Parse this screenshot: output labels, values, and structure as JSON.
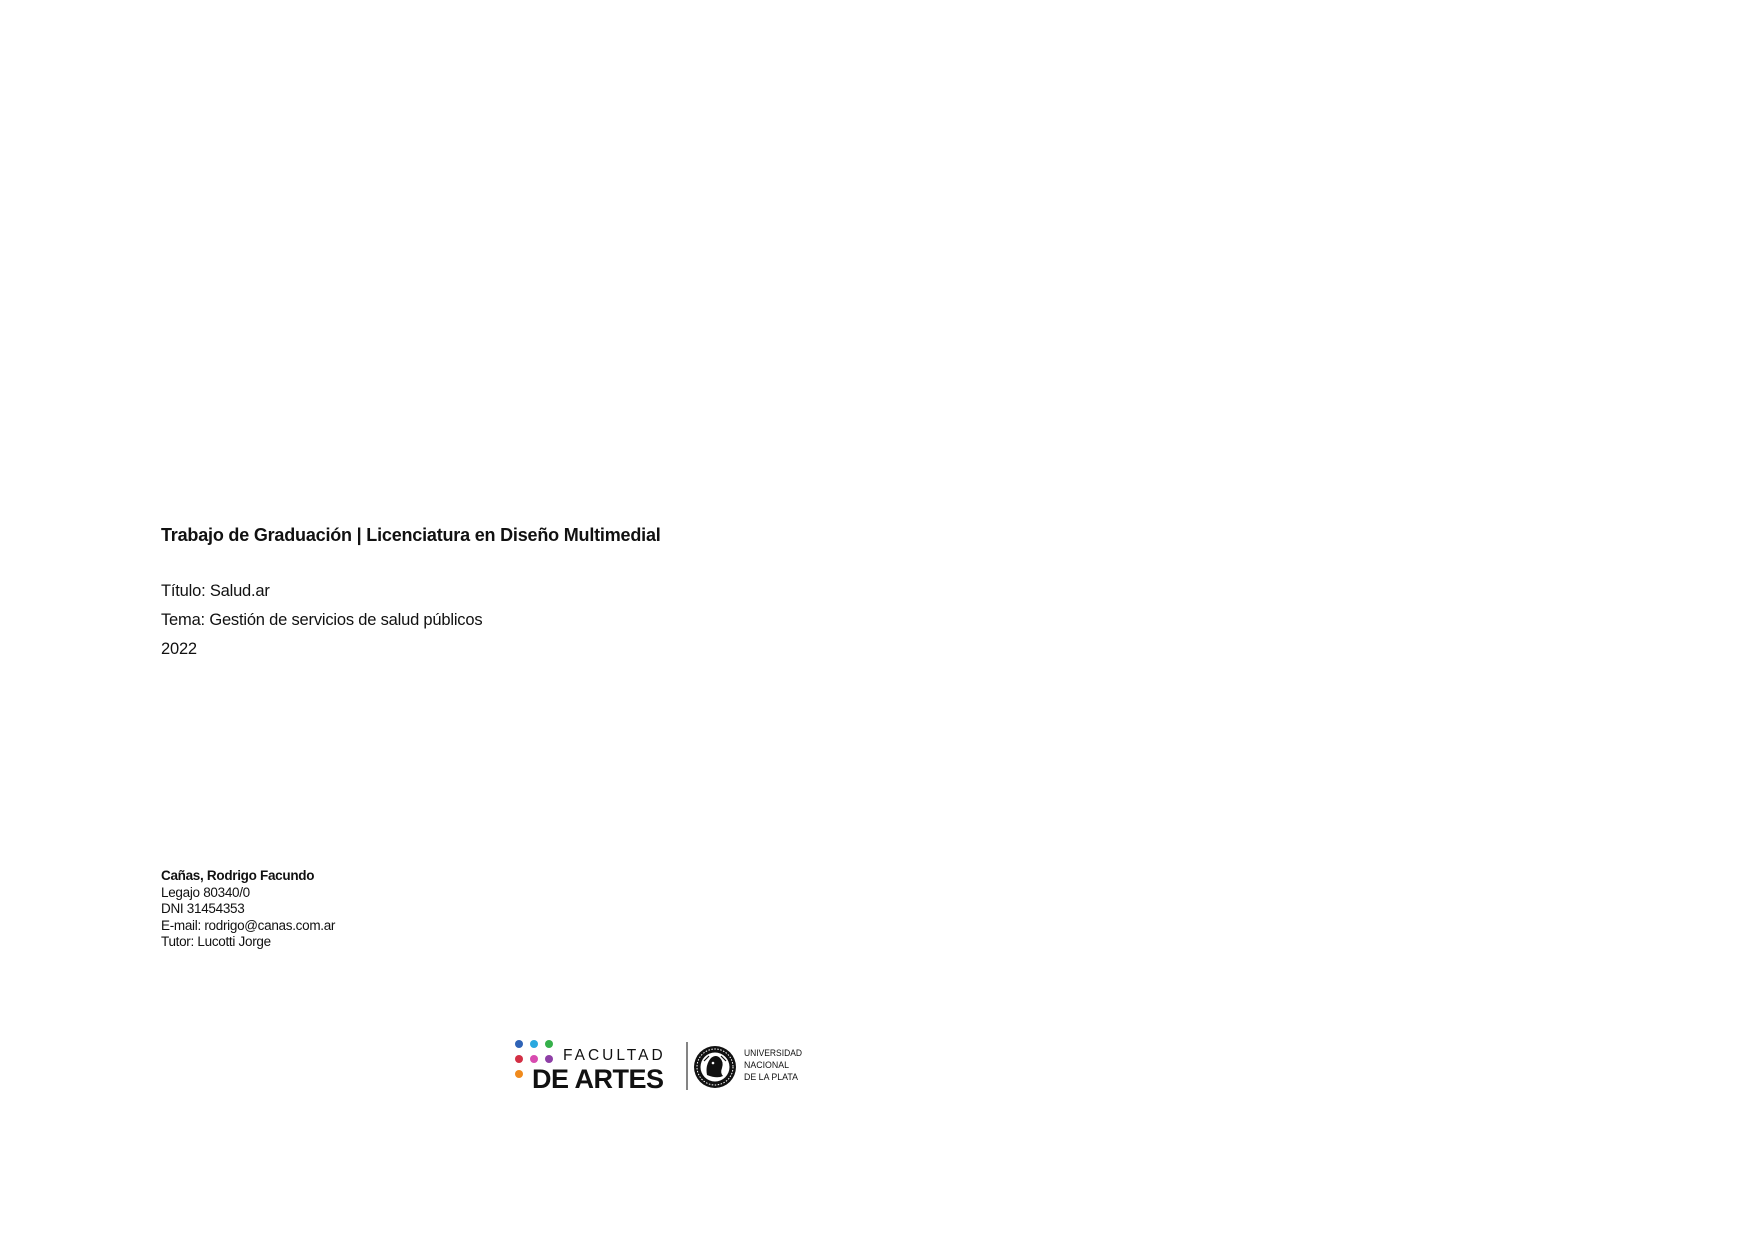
{
  "heading": "Trabajo de Graduación | Licenciatura en Diseño Multimedial",
  "details": [
    "Título: Salud.ar",
    "Tema: Gestión de servicios de salud públicos",
    "2022"
  ],
  "author": {
    "name": "Cañas, Rodrigo Facundo",
    "lines": [
      "Legajo 80340/0",
      "DNI 31454353",
      "E-mail: rodrigo@canas.com.ar",
      "Tutor: Lucotti Jorge"
    ]
  },
  "logos": {
    "faculty_line1": "FACULTAD",
    "faculty_line2": "DE ARTES",
    "university_line1": "UNIVERSIDAD",
    "university_line2": "NACIONAL",
    "university_line3": "DE LA PLATA",
    "faculty_icon": "colored-dots-icon",
    "university_icon": "unlp-seal-icon",
    "dot_colors": [
      "#2f63b6",
      "#29a8df",
      "#35b04a",
      "#d32f45",
      "#d84bb0",
      "#8e3fa6",
      "#f08a1c"
    ],
    "ink_color": "#111111"
  }
}
